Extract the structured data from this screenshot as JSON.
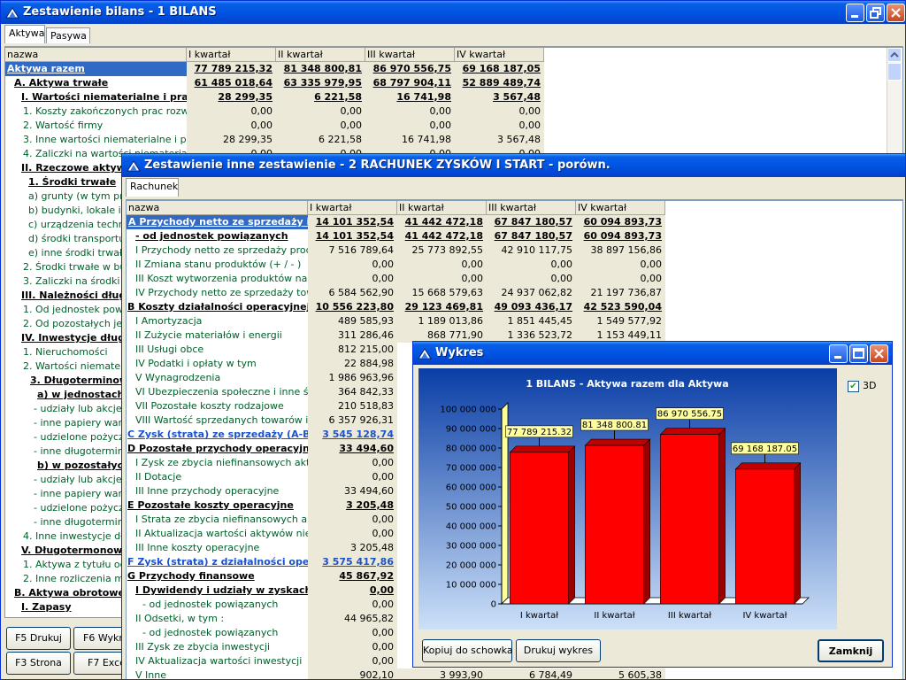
{
  "win1": {
    "title": "Zestawienie bilans - 1 BILANS",
    "tabs": [
      "Aktywa",
      "Pasywa"
    ],
    "columns": [
      "nazwa",
      "I kwartał",
      "II kwartał",
      "III kwartał",
      "IV kwartał"
    ],
    "rows": [
      {
        "name": "Aktywa razem",
        "style": "sel",
        "v": [
          "77 789 215,32",
          "81 348 800,81",
          "86 970 556,75",
          "69 168 187,05"
        ]
      },
      {
        "name": "A. Aktywa trwałe",
        "style": "b1",
        "v": [
          "61 485 018,64",
          "63 335 979,95",
          "68 797 904,11",
          "52 889 489,74"
        ]
      },
      {
        "name": "I. Wartości niematerialne i prawne",
        "style": "b2",
        "v": [
          "28 299,35",
          "6 221,58",
          "16 741,98",
          "3 567,48"
        ]
      },
      {
        "name": "1. Koszty zakończonych prac rozwojowych",
        "style": "n",
        "v": [
          "0,00",
          "0,00",
          "0,00",
          "0,00"
        ]
      },
      {
        "name": "2. Wartość firmy",
        "style": "n",
        "v": [
          "0,00",
          "0,00",
          "0,00",
          "0,00"
        ]
      },
      {
        "name": "3. Inne wartości niematerialne i prawne",
        "style": "n",
        "v": [
          "28 299,35",
          "6 221,58",
          "16 741,98",
          "3 567,48"
        ]
      },
      {
        "name": "4. Zaliczki na wartości niematerialne i",
        "style": "n",
        "v": [
          "0,00",
          "0,00",
          "0,00",
          "0,00"
        ]
      },
      {
        "name": "II. Rzeczowe aktywa",
        "style": "b2",
        "v": []
      },
      {
        "name": "1. Środki trwałe",
        "style": "b3",
        "v": []
      },
      {
        "name": "a) grunty (w tym prawo",
        "style": "n3",
        "v": []
      },
      {
        "name": "b) budynki, lokale i ob",
        "style": "n3",
        "v": []
      },
      {
        "name": "c) urządzenia technic",
        "style": "n3",
        "v": []
      },
      {
        "name": "d) środki transportu",
        "style": "n3",
        "v": []
      },
      {
        "name": "e) inne środki trwałe",
        "style": "n3",
        "v": []
      },
      {
        "name": "2. Środki trwałe w budo",
        "style": "n",
        "v": []
      },
      {
        "name": "3. Zaliczki na środki trw",
        "style": "n",
        "v": []
      },
      {
        "name": "III. Należności długo",
        "style": "b2",
        "v": []
      },
      {
        "name": "1. Od jednostek powiąz",
        "style": "n",
        "v": []
      },
      {
        "name": "2. Od pozostałych jedn",
        "style": "n",
        "v": []
      },
      {
        "name": "IV. Inwestycje długo",
        "style": "b2",
        "v": []
      },
      {
        "name": "1. Nieruchomości",
        "style": "n",
        "v": []
      },
      {
        "name": "2. Wartości niematerial",
        "style": "n",
        "v": []
      },
      {
        "name": "3. Długoterminowe",
        "style": "b4",
        "v": []
      },
      {
        "name": "a) w jednostach",
        "style": "b5",
        "v": []
      },
      {
        "name": "- udziały lub akcje",
        "style": "n5",
        "v": []
      },
      {
        "name": "- inne papiery warto",
        "style": "n5",
        "v": []
      },
      {
        "name": "- udzielone pożyczki",
        "style": "n5",
        "v": []
      },
      {
        "name": "- inne długotermino",
        "style": "n5",
        "v": []
      },
      {
        "name": "b) w pozostałych",
        "style": "b5",
        "v": []
      },
      {
        "name": "- udziały lub akcje",
        "style": "n5",
        "v": []
      },
      {
        "name": "- inne papiery warto",
        "style": "n5",
        "v": []
      },
      {
        "name": "- udzielone pożyczki",
        "style": "n5",
        "v": []
      },
      {
        "name": "- inne długotermino",
        "style": "n5",
        "v": []
      },
      {
        "name": "4. Inne inwestycje dług",
        "style": "n",
        "v": []
      },
      {
        "name": "V. Długotermonowe",
        "style": "b2",
        "v": []
      },
      {
        "name": "1. Aktywa z tytułu odro",
        "style": "n",
        "v": []
      },
      {
        "name": "2. Inne rozliczenia międ",
        "style": "n",
        "v": []
      },
      {
        "name": "B. Aktywa obrotowe",
        "style": "b1",
        "v": []
      },
      {
        "name": "I. Zapasy",
        "style": "b2",
        "v": []
      }
    ],
    "buttons": [
      "F5 Drukuj",
      "F6 Wykr",
      "F3 Strona",
      "F7 Exce"
    ]
  },
  "win2": {
    "title": "Zestawienie inne zestawienie - 2 RACHUNEK ZYSKÓW I START - porówn.",
    "tab": "Rachunek",
    "columns": [
      "nazwa",
      "I kwartał",
      "II kwartał",
      "III kwartał",
      "IV kwartał"
    ],
    "rows": [
      {
        "name": "A Przychody netto ze sprzedaży i zr",
        "style": "sel",
        "v": [
          "14 101 352,54",
          "41 442 472,18",
          "67 847 180,57",
          "60 094 893,73"
        ]
      },
      {
        "name": "- od jednostek powiązanych",
        "style": "b1",
        "v": [
          "14 101 352,54",
          "41 442 472,18",
          "67 847 180,57",
          "60 094 893,73"
        ]
      },
      {
        "name": "I Przychody netto ze sprzedaży produkt",
        "style": "g",
        "v": [
          "7 516 789,64",
          "25 773 892,55",
          "42 910 117,75",
          "38 897 156,86"
        ]
      },
      {
        "name": "II Zmiana stanu produktów (+ / - )",
        "style": "g",
        "v": [
          "0,00",
          "0,00",
          "0,00",
          "0,00"
        ]
      },
      {
        "name": "III Koszt wytworzenia produktów na włas",
        "style": "g",
        "v": [
          "0,00",
          "0,00",
          "0,00",
          "0,00"
        ]
      },
      {
        "name": "IV Przychody netto ze sprzedaży towarów",
        "style": "g",
        "v": [
          "6 584 562,90",
          "15 668 579,63",
          "24 937 062,82",
          "21 197 736,87"
        ]
      },
      {
        "name": "B Koszty działalności operacyjnej",
        "style": "b0",
        "v": [
          "10 556 223,80",
          "29 123 469,81",
          "49 093 436,17",
          "42 523 590,04"
        ]
      },
      {
        "name": "I Amortyzacja",
        "style": "g",
        "v": [
          "489 585,93",
          "1 189 013,86",
          "1 851 445,45",
          "1 549 577,92"
        ]
      },
      {
        "name": "II Zużycie materiałów i energii",
        "style": "g",
        "v": [
          "311 286,46",
          "868 771,90",
          "1 336 523,72",
          "1 153 449,11"
        ]
      },
      {
        "name": "III Usługi obce",
        "style": "g",
        "v": [
          "812 215,00"
        ]
      },
      {
        "name": "IV Podatki i opłaty w tym",
        "style": "g",
        "v": [
          "22 884,98"
        ]
      },
      {
        "name": "V Wynagrodzenia",
        "style": "g",
        "v": [
          "1 986 963,96"
        ]
      },
      {
        "name": "VI Ubezpieczenia społeczne i inne świad",
        "style": "g",
        "v": [
          "364 842,33"
        ]
      },
      {
        "name": "VII Pozostałe koszty rodzajowe",
        "style": "g",
        "v": [
          "210 518,83"
        ]
      },
      {
        "name": "VIII Wartość sprzedanych towarów i mat",
        "style": "g",
        "v": [
          "6 357 926,31"
        ]
      },
      {
        "name": "C Zysk (strata) ze sprzedaży (A-B)",
        "style": "blue",
        "v": [
          "3 545 128,74"
        ]
      },
      {
        "name": "D Pozostałe przychody operacyjne",
        "style": "b0",
        "v": [
          "33 494,60"
        ]
      },
      {
        "name": "I Zysk ze zbycia niefinansowych aktywów",
        "style": "g",
        "v": [
          "0,00"
        ]
      },
      {
        "name": "II Dotacje",
        "style": "g",
        "v": [
          "0,00"
        ]
      },
      {
        "name": "III Inne przychody operacyjne",
        "style": "g",
        "v": [
          "33 494,60"
        ]
      },
      {
        "name": "E Pozostałe koszty operacyjne",
        "style": "b0",
        "v": [
          "3 205,48"
        ]
      },
      {
        "name": "I Strata ze zbycia niefinansowych aktyw",
        "style": "g",
        "v": [
          "0,00"
        ]
      },
      {
        "name": "II Aktualizacja wartości aktywów niefinan",
        "style": "g",
        "v": [
          "0,00"
        ]
      },
      {
        "name": "III Inne koszty operacyjne",
        "style": "g",
        "v": [
          "3 205,48"
        ]
      },
      {
        "name": "F Zysk (strata) z działalności opera",
        "style": "blue",
        "v": [
          "3 575 417,86"
        ]
      },
      {
        "name": "G Przychody finansowe",
        "style": "b0",
        "v": [
          "45 867,92"
        ]
      },
      {
        "name": "I Dywidendy i udziały w zyskach,",
        "style": "b1",
        "v": [
          "0,00"
        ]
      },
      {
        "name": "- od jednostek powiązanych",
        "style": "g2",
        "v": [
          "0,00"
        ]
      },
      {
        "name": "II Odsetki, w tym :",
        "style": "g",
        "v": [
          "44 965,82"
        ]
      },
      {
        "name": "- od jednostek powiązanych",
        "style": "g2",
        "v": [
          "0,00"
        ]
      },
      {
        "name": "III Zysk ze zbycia inwestycji",
        "style": "g",
        "v": [
          "0,00"
        ]
      },
      {
        "name": "IV Aktualizacja wartości inwestycji",
        "style": "g",
        "v": [
          "0,00"
        ]
      },
      {
        "name": "V Inne",
        "style": "g",
        "v": [
          "902,10",
          "3 993,90",
          "6 784,49",
          "5 605,38"
        ]
      }
    ]
  },
  "win3": {
    "title": "Wykres",
    "chart_title": "1 BILANS -  Aktywa razem dla Aktywa",
    "checkbox_label": "3D",
    "checkbox_checked": true,
    "buttons": {
      "copy": "Kopiuj do schowka",
      "print": "Drukuj wykres",
      "close": "Zamknij"
    },
    "colors": {
      "bar": "#ff0000",
      "frame": "#ffff99",
      "bg_top": "#0a3ea6",
      "bg_bottom": "#cce0f8"
    }
  },
  "chart_data": {
    "type": "bar",
    "title": "1 BILANS -  Aktywa razem dla Aktywa",
    "categories": [
      "I kwartał",
      "II kwartał",
      "III kwartał",
      "IV kwartał"
    ],
    "values": [
      77789215.32,
      81348800.81,
      86970556.75,
      69168187.05
    ],
    "data_labels": [
      "77 789 215.32",
      "81 348 800.81",
      "86 970 556.75",
      "69 168 187.05"
    ],
    "ylim": [
      0,
      100000000
    ],
    "yticks": [
      "0",
      "10 000 000",
      "20 000 000",
      "30 000 000",
      "40 000 000",
      "50 000 000",
      "60 000 000",
      "70 000 000",
      "80 000 000",
      "90 000 000",
      "100 000 000"
    ],
    "three_d": true,
    "grid": false
  }
}
